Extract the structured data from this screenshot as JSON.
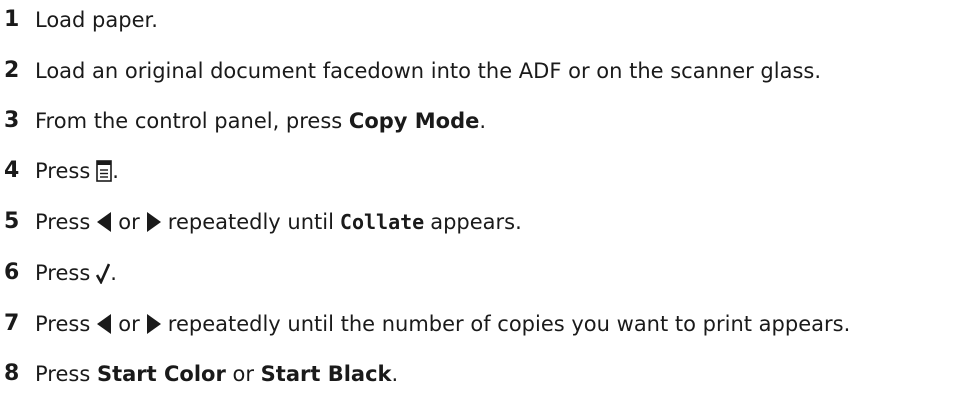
{
  "steps": [
    {
      "number": "1",
      "text": "Load paper."
    },
    {
      "number": "2",
      "text": "Load an original document facedown into the ADF or on the scanner glass."
    },
    {
      "number": "3",
      "text_before": "From the control panel, press ",
      "bold": "Copy Mode",
      "text_after": "."
    },
    {
      "number": "4",
      "text_before": "Press",
      "icon": "menu-icon",
      "text_after": "."
    },
    {
      "number": "5",
      "text_before": "Press",
      "icon_left": "left-arrow-icon",
      "or": "or",
      "icon_right": "right-arrow-icon",
      "text_middle": "repeatedly until",
      "code": "Collate",
      "text_after": "appears."
    },
    {
      "number": "6",
      "text_before": "Press",
      "icon": "checkmark-icon",
      "text_after": "."
    },
    {
      "number": "7",
      "text_before": "Press",
      "icon_left": "left-arrow-icon",
      "or": "or",
      "icon_right": "right-arrow-icon",
      "text_after": "repeatedly until the number of copies you want to print appears."
    },
    {
      "number": "8",
      "text_before": "Press ",
      "bold1": "Start Color",
      "or": " or ",
      "bold2": "Start Black",
      "text_after": "."
    }
  ]
}
